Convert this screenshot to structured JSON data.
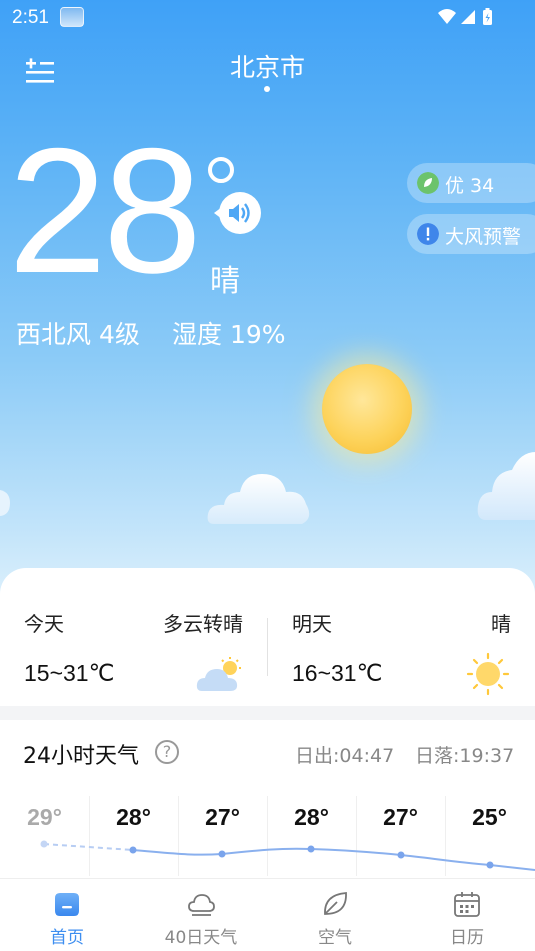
{
  "status_bar": {
    "time": "2:51"
  },
  "header": {
    "city": "北京市"
  },
  "current": {
    "temperature": "28",
    "condition": "晴",
    "wind": "西北风 4级",
    "humidity": "湿度 19%"
  },
  "badges": {
    "aqi": "优 34",
    "alert": "大风预警"
  },
  "forecast": {
    "today": {
      "label": "今天",
      "condition": "多云转晴",
      "range": "15~31℃"
    },
    "tomorrow": {
      "label": "明天",
      "condition": "晴",
      "range": "16~31℃"
    }
  },
  "hourly": {
    "title": "24小时天气",
    "sunrise": "日出:04:47",
    "sunset": "日落:19:37",
    "temps": [
      "29°",
      "28°",
      "27°",
      "28°",
      "27°",
      "25°"
    ]
  },
  "tabs": [
    {
      "label": "首页",
      "icon": "home-icon",
      "active": true
    },
    {
      "label": "40日天气",
      "icon": "cloud-icon",
      "active": false
    },
    {
      "label": "空气",
      "icon": "leaf-icon",
      "active": false
    },
    {
      "label": "日历",
      "icon": "calendar-icon",
      "active": false
    }
  ],
  "colors": {
    "accent": "#3d8ef0",
    "aqi_good": "#6cc36c",
    "alert": "#3f86ea"
  }
}
